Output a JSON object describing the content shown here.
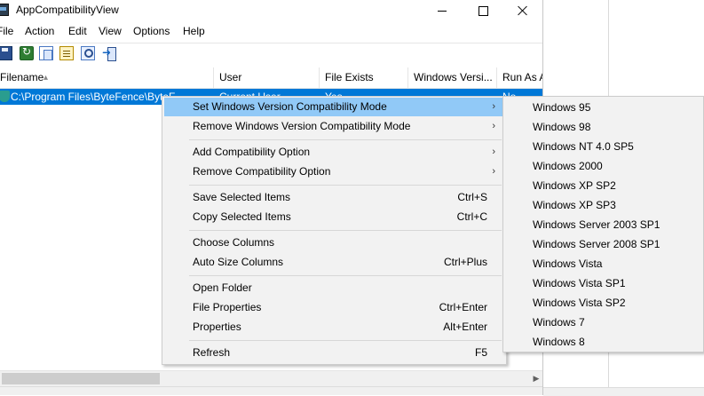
{
  "window": {
    "title": "AppCompatibilityView"
  },
  "menubar": {
    "items": [
      "File",
      "Action",
      "Edit",
      "View",
      "Options",
      "Help"
    ]
  },
  "toolbar": {
    "icons": [
      "save-icon",
      "refresh-icon",
      "copy-icon",
      "properties-icon",
      "find-icon",
      "exit-icon"
    ]
  },
  "list": {
    "columns": [
      "Filename",
      "User",
      "File Exists",
      "Windows Versi...",
      "Run As A"
    ],
    "rows": [
      {
        "filename": "C:\\Program Files\\ByteFence\\ByteF",
        "user": "Current User",
        "file_exists": "Yes",
        "run_as": "No"
      }
    ]
  },
  "context_menu": {
    "items": [
      {
        "label": "Set Windows Version Compatibility Mode",
        "submenu": true,
        "highlighted": true
      },
      {
        "label": "Remove Windows Version Compatibility Mode",
        "submenu": true
      },
      {
        "label": "Add Compatibility Option",
        "submenu": true
      },
      {
        "label": "Remove Compatibility Option",
        "submenu": true
      },
      {
        "label": "Save Selected Items",
        "shortcut": "Ctrl+S"
      },
      {
        "label": "Copy Selected Items",
        "shortcut": "Ctrl+C"
      },
      {
        "label": "Choose Columns"
      },
      {
        "label": "Auto Size Columns",
        "shortcut": "Ctrl+Plus"
      },
      {
        "label": "Open Folder"
      },
      {
        "label": "File Properties",
        "shortcut": "Ctrl+Enter"
      },
      {
        "label": "Properties",
        "shortcut": "Alt+Enter"
      },
      {
        "label": "Refresh",
        "shortcut": "F5"
      }
    ]
  },
  "submenu": {
    "items": [
      "Windows 95",
      "Windows 98",
      "Windows NT 4.0 SP5",
      "Windows 2000",
      "Windows XP SP2",
      "Windows XP SP3",
      "Windows Server 2003 SP1",
      "Windows Server 2008 SP1",
      "Windows Vista",
      "Windows Vista SP1",
      "Windows Vista SP2",
      "Windows 7",
      "Windows 8"
    ]
  },
  "colors": {
    "selection": "#0078d7",
    "menu_highlight": "#91c9f7",
    "menu_background": "#f2f2f2"
  }
}
